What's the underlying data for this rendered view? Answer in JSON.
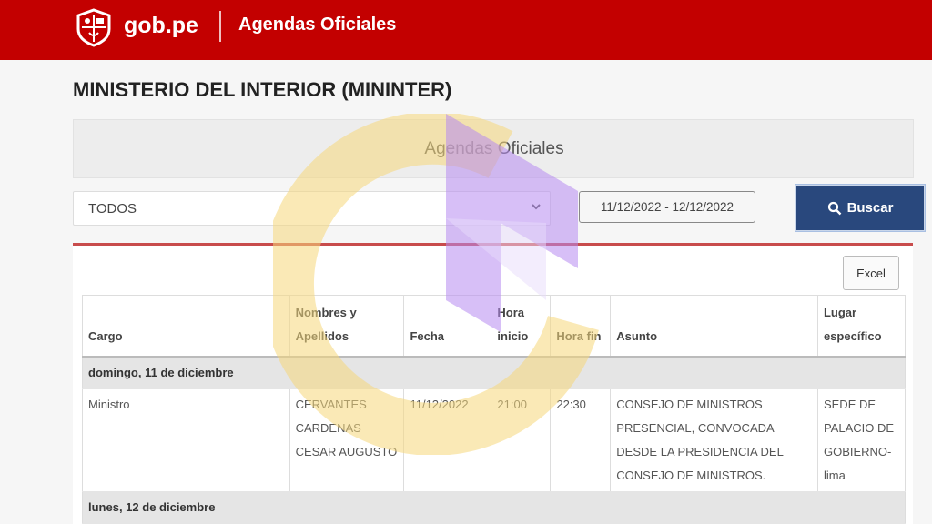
{
  "header": {
    "brand": "gob.pe",
    "section": "Agendas Oficiales",
    "logo_icon": "peru-coat-of-arms-icon",
    "bg_color": "#c30000"
  },
  "page_title": "MINISTERIO DEL INTERIOR (MININTER)",
  "panel_title": "Agendas Oficiales",
  "filters": {
    "select_value": "TODOS",
    "date_range": "11/12/2022 - 12/12/2022",
    "search_label": "Buscar",
    "search_icon": "search-icon"
  },
  "excel_label": "Excel",
  "table": {
    "headers": [
      "Cargo",
      "Nombres y Apellidos",
      "Fecha",
      "Hora inicio",
      "Hora fin",
      "Asunto",
      "Lugar específico"
    ],
    "groups": [
      {
        "label": "domingo, 11 de diciembre",
        "rows": [
          {
            "cargo": "Ministro",
            "nombres": "CERVANTES CARDENAS CESAR AUGUSTO",
            "fecha": "11/12/2022",
            "hora_inicio": "21:00",
            "hora_fin": "22:30",
            "asunto": "CONSEJO DE MINISTROS PRESENCIAL, CONVOCADA DESDE LA PRESIDENCIA DEL CONSEJO DE MINISTROS.",
            "lugar": "SEDE DE PALACIO DE GOBIERNO-lima"
          }
        ]
      },
      {
        "label": "lunes, 12 de diciembre",
        "rows": []
      }
    ]
  }
}
